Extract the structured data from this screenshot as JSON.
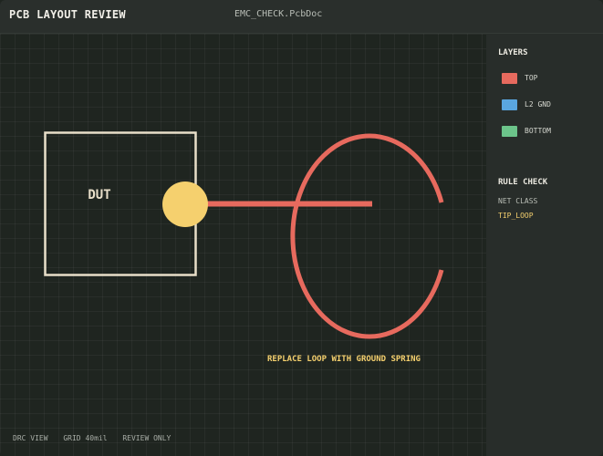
{
  "window": {
    "app_title": "PCB LAYOUT REVIEW",
    "document_title": "EMC_CHECK.PcbDoc"
  },
  "canvas": {
    "component_label": "DUT",
    "annotation": "REPLACE LOOP WITH GROUND SPRING",
    "colors": {
      "outline": "#e8dfc9",
      "pad": "#f5d06e",
      "trace": "#e76a5e",
      "annotation": "#f5d06e"
    }
  },
  "status_bar": {
    "items": [
      "DRC VIEW",
      "GRID 40mil",
      "REVIEW ONLY"
    ]
  },
  "layers_panel": {
    "heading": "LAYERS",
    "items": [
      {
        "label": "TOP",
        "color": "#e76a5e"
      },
      {
        "label": "L2 GND",
        "color": "#5aa6e0"
      },
      {
        "label": "BOTTOM",
        "color": "#6cc48a"
      }
    ]
  },
  "rule_check": {
    "heading": "RULE CHECK",
    "net_class_label": "NET CLASS",
    "net_class_value": "TIP_LOOP",
    "value_color": "#f5d06e"
  }
}
